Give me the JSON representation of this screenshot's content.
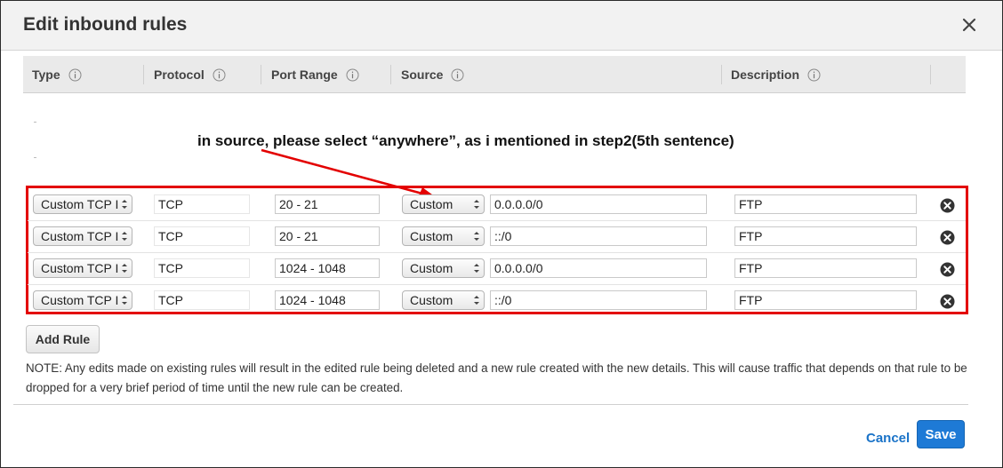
{
  "dialog": {
    "title": "Edit inbound rules",
    "close_icon": "close-icon"
  },
  "columns": [
    {
      "label": "Type",
      "icon": "info-icon"
    },
    {
      "label": "Protocol",
      "icon": "info-icon"
    },
    {
      "label": "Port Range",
      "icon": "info-icon"
    },
    {
      "label": "Source",
      "icon": "info-icon"
    },
    {
      "label": "Description",
      "icon": "info-icon"
    }
  ],
  "annotation": {
    "text": "in source, please select “anywhere”, as i mentioned in step2(5th sentence)",
    "color": "#e30000"
  },
  "rules": [
    {
      "type": "Custom TCP I",
      "protocol": "TCP",
      "port_range": "20 - 21",
      "source_type": "Custom",
      "source_value": "0.0.0.0/0",
      "description": "FTP"
    },
    {
      "type": "Custom TCP I",
      "protocol": "TCP",
      "port_range": "20 - 21",
      "source_type": "Custom",
      "source_value": "::/0",
      "description": "FTP"
    },
    {
      "type": "Custom TCP I",
      "protocol": "TCP",
      "port_range": "1024 - 1048",
      "source_type": "Custom",
      "source_value": "0.0.0.0/0",
      "description": "FTP"
    },
    {
      "type": "Custom TCP I",
      "protocol": "TCP",
      "port_range": "1024 - 1048",
      "source_type": "Custom",
      "source_value": "::/0",
      "description": "FTP"
    }
  ],
  "actions": {
    "add_rule": "Add Rule",
    "cancel": "Cancel",
    "save": "Save"
  },
  "note": "NOTE: Any edits made on existing rules will result in the edited rule being deleted and a new rule created with the new details. This will cause traffic that depends on that rule to be dropped for a very brief period of time until the new rule can be created.",
  "colors": {
    "accent": "#1e7ad6",
    "link": "#1a73c8",
    "highlight": "#e30000"
  }
}
